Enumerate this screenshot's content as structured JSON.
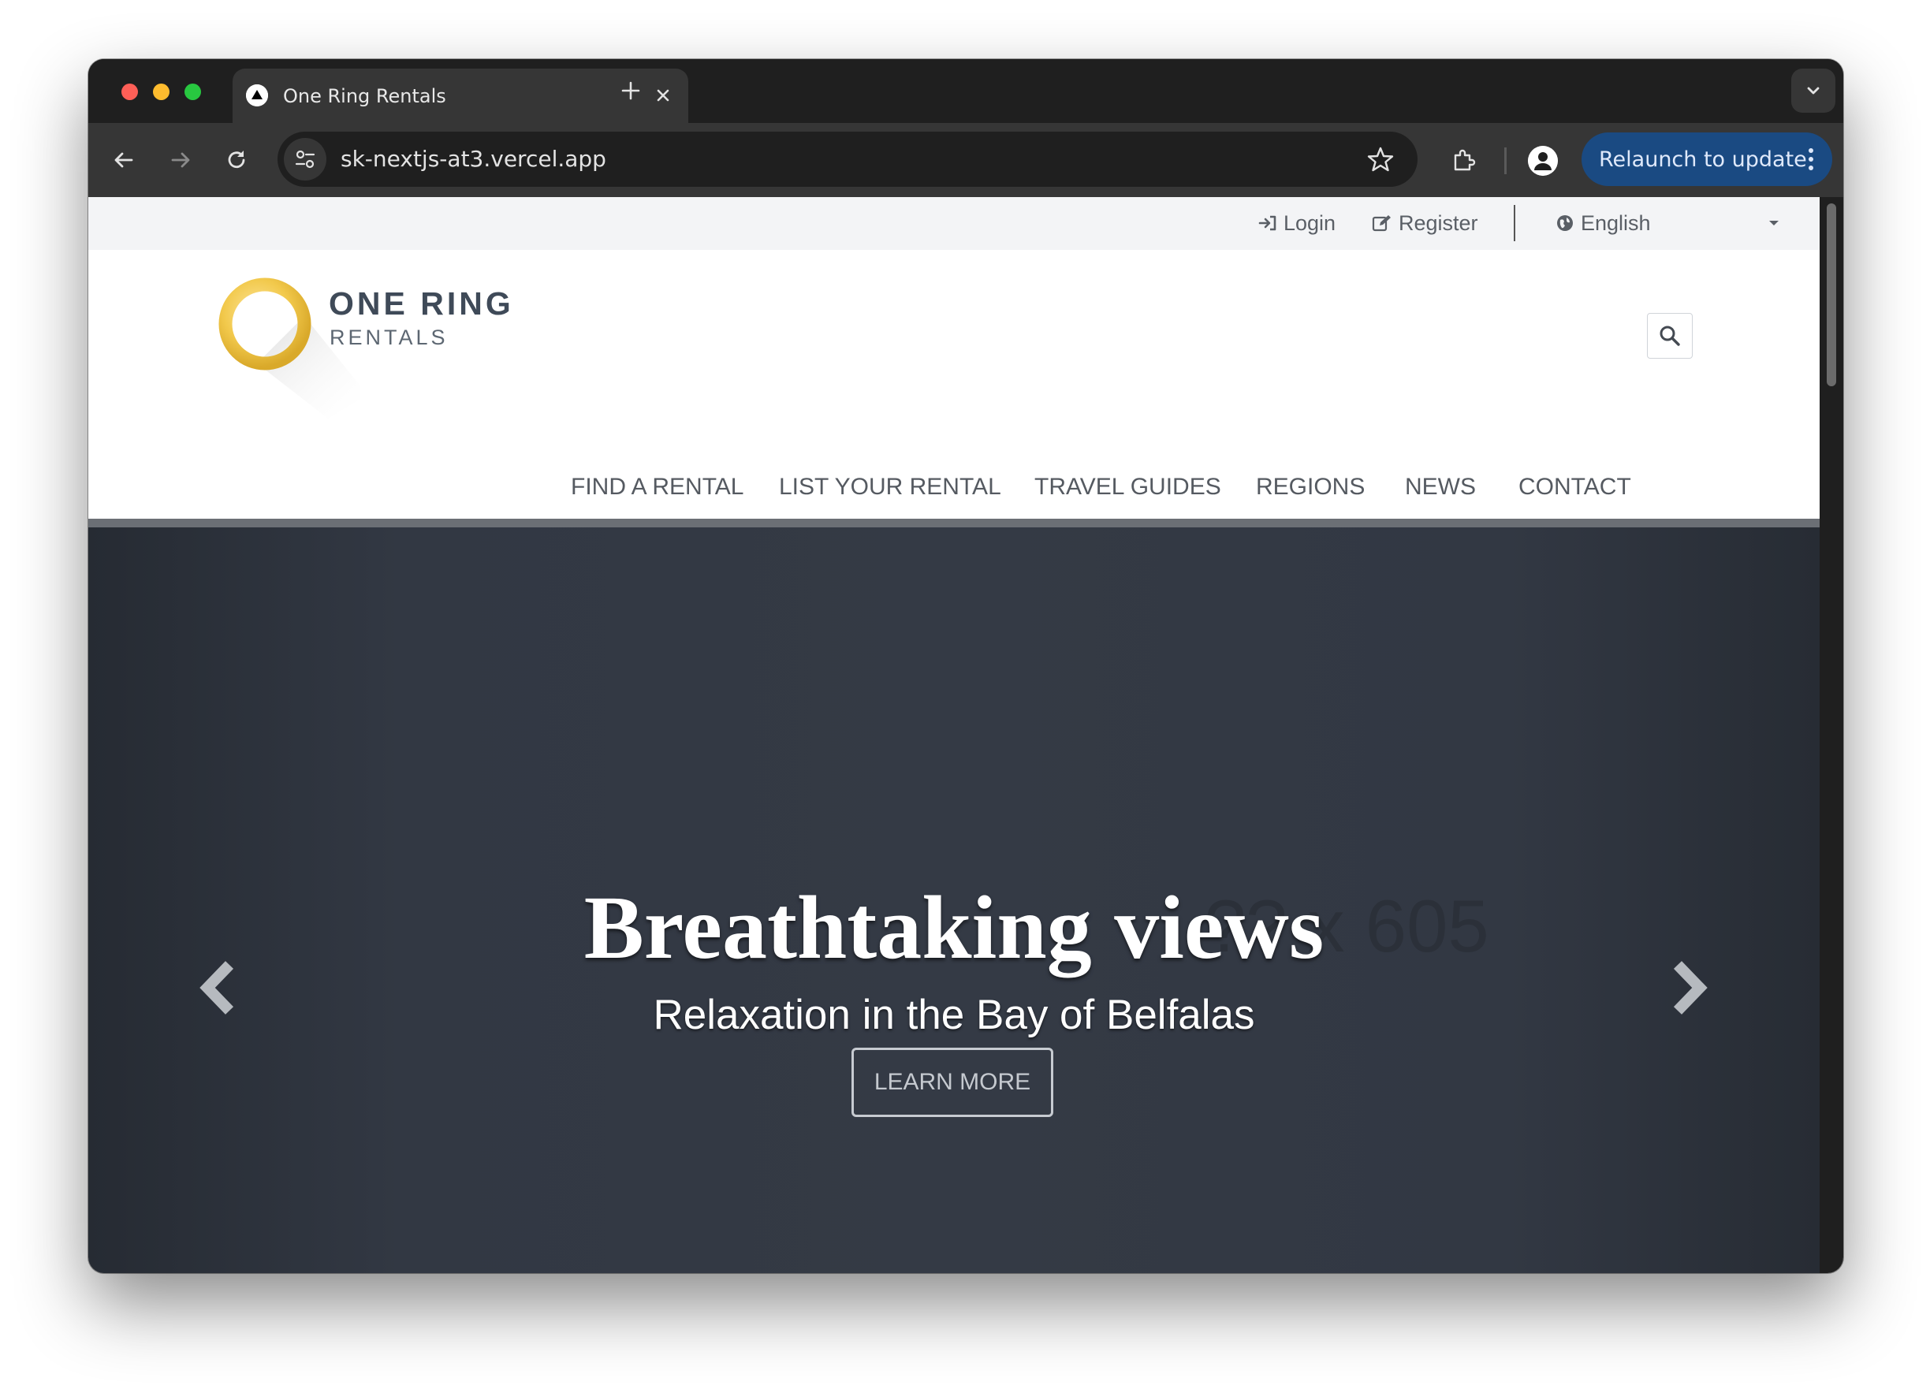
{
  "browser": {
    "tab_title": "One Ring Rentals",
    "url": "sk-nextjs-at3.vercel.app",
    "relaunch_label": "Relaunch to update"
  },
  "topbar": {
    "login": "Login",
    "register": "Register",
    "language": "English"
  },
  "header": {
    "logo_line1": "ONE RING",
    "logo_line2": "RENTALS",
    "nav": [
      "FIND A RENTAL",
      "LIST YOUR RENTAL",
      "TRAVEL GUIDES",
      "REGIONS",
      "NEWS",
      "CONTACT"
    ]
  },
  "hero": {
    "placeholder_text": "?? x 605",
    "title": "Breathtaking views",
    "subtitle": "Relaxation in the Bay of Belfalas",
    "button": "LEARN MORE"
  },
  "colors": {
    "hero_bg": "#343a45",
    "logo_ring": "#f2c94c",
    "relaunch_bg": "#1a4a82"
  }
}
